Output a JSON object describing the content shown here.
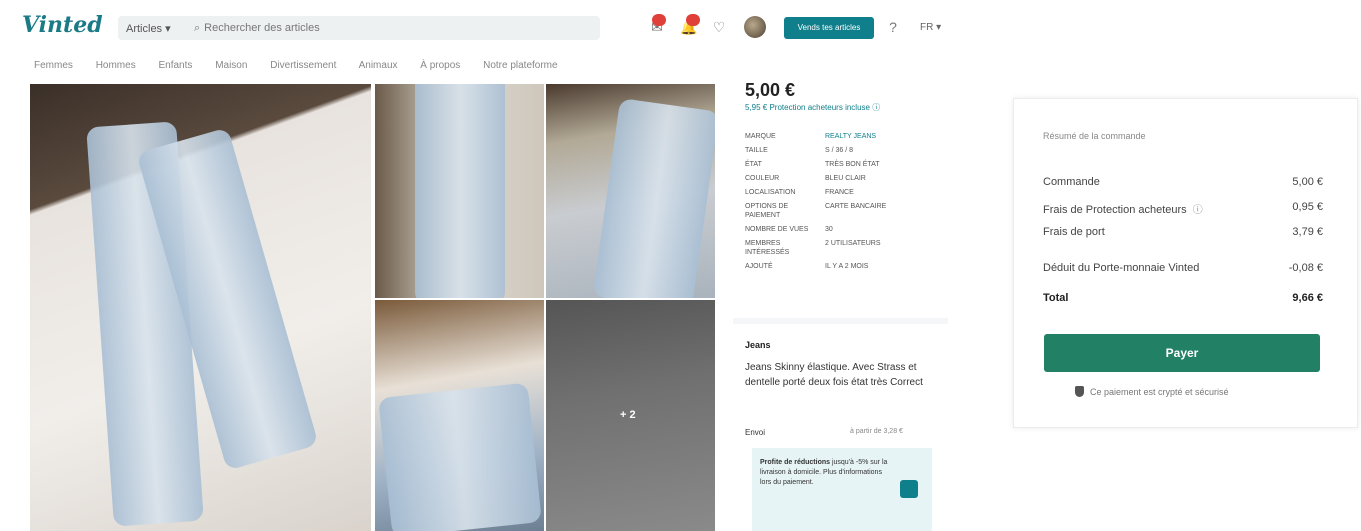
{
  "header": {
    "logo": "Vinted",
    "category_select": "Articles ▾",
    "search_placeholder": "Rechercher des articles",
    "sell_button": "Vends tes articles",
    "language": "FR ▾"
  },
  "nav": [
    "Femmes",
    "Hommes",
    "Enfants",
    "Maison",
    "Divertissement",
    "Animaux",
    "À propos",
    "Notre plateforme"
  ],
  "gallery": {
    "more_label": "+ 2"
  },
  "item": {
    "price": "5,00 €",
    "protection_line": "5,95 € Protection acheteurs incluse",
    "properties": [
      {
        "key": "Marque",
        "value": "Realty Jeans"
      },
      {
        "key": "Taille",
        "value": "S / 36 / 8"
      },
      {
        "key": "État",
        "value": "Très bon état"
      },
      {
        "key": "Couleur",
        "value": "Bleu clair"
      },
      {
        "key": "Localisation",
        "value": "France"
      },
      {
        "key": "Options de paiement",
        "value": "Carte bancaire"
      },
      {
        "key": "Nombre de vues",
        "value": "30"
      },
      {
        "key": "Membres intéressés",
        "value": "2 utilisateurs"
      },
      {
        "key": "Ajouté",
        "value": "Il y a 2 mois"
      }
    ],
    "title": "Jeans",
    "description": "Jeans Skinny élastique. Avec Strass et dentelle porté deux fois état très Correct",
    "shipping_label": "Envoi",
    "shipping_value": "à partir de 3,28 €",
    "promo_title": "Profite de réductions",
    "promo_text": "jusqu'à -5% sur la livraison à domicile. Plus d'informations lors du paiement."
  },
  "summary": {
    "title": "Résumé de la commande",
    "rows": [
      {
        "label": "Commande",
        "value": "5,00 €"
      },
      {
        "label": "Frais de Protection acheteurs",
        "value": "0,95 €"
      },
      {
        "label": "Frais de port",
        "value": "3,79 €"
      },
      {
        "label": "Déduit du Porte-monnaie Vinted",
        "value": "-0,08 €"
      }
    ],
    "total_label": "Total",
    "total_value": "9,66 €",
    "pay_button": "Payer",
    "secure_text": "Ce paiement est crypté et sécurisé"
  }
}
